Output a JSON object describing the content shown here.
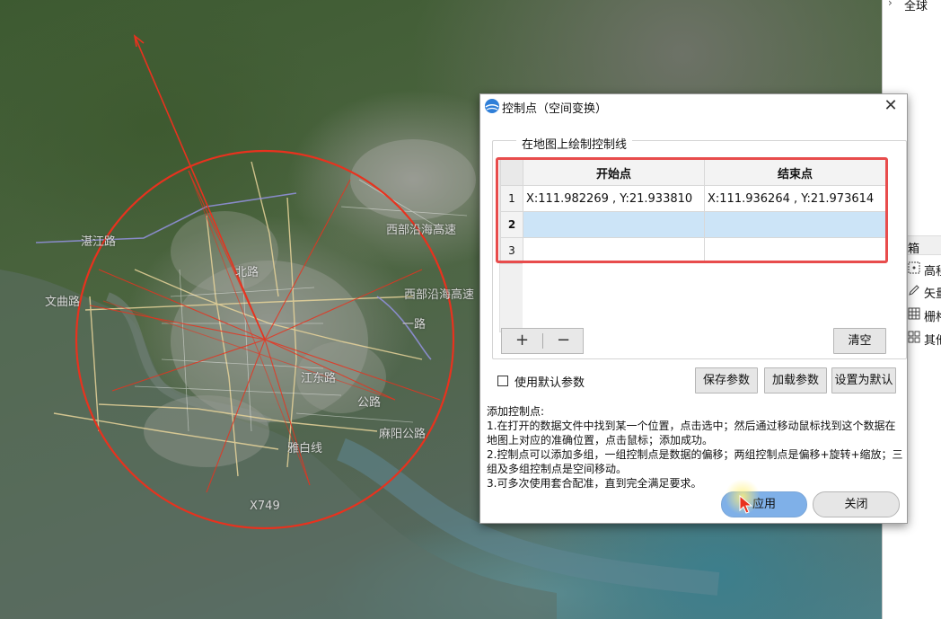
{
  "map": {
    "labels": {
      "west_coast_highway_1": "西部沿海高速",
      "west_coast_highway_2": "西部沿海高速",
      "north_road": "北路",
      "x749": "X749",
      "mayang_road": "麻阳公路",
      "east_jiang_road": "江东路",
      "yabai_line": "雅白线",
      "road_1": "一路",
      "wenqu_road": "文曲路",
      "zhanjiang_road": "湛江路",
      "mayang_road_2": "公路"
    },
    "overlay_color": "#e8321e",
    "road_color": "#e8d49a"
  },
  "right_panel": {
    "top_item": "全球",
    "section_label": "箱",
    "items": [
      "高程",
      "矢量",
      "栅格",
      "其他"
    ]
  },
  "dialog": {
    "title": "控制点（空间变换）",
    "group_label": "在地图上绘制控制线",
    "table": {
      "headers": [
        "开始点",
        "结束点"
      ],
      "rows": [
        {
          "num": "1",
          "start": "X:111.982269 , Y:21.933810",
          "end": "X:111.936264 , Y:21.973614"
        },
        {
          "num": "2",
          "start": "",
          "end": ""
        },
        {
          "num": "3",
          "start": "",
          "end": ""
        }
      ],
      "selected_row": "2"
    },
    "buttons": {
      "add": "+",
      "remove": "−",
      "clear": "清空",
      "save_params": "保存参数",
      "load_params": "加载参数",
      "set_default": "设置为默认",
      "apply": "应用",
      "close": "关闭"
    },
    "checkbox_label": "使用默认参数",
    "help": {
      "title": "添加控制点:",
      "lines": [
        "1.在打开的数据文件中找到某一个位置，点击选中；然后通过移动鼠标找到这个数据在地图上对应的准确位置，点击鼠标；添加成功。",
        "2.控制点可以添加多组，一组控制点是数据的偏移；两组控制点是偏移+旋转+缩放；三组及多组控制点是空间移动。",
        "3.可多次使用套合配准，直到完全满足要求。"
      ]
    },
    "highlight_color": "#e84c4c",
    "selected_row_color": "#cce4f7",
    "apply_color": "#7fb0e8"
  }
}
